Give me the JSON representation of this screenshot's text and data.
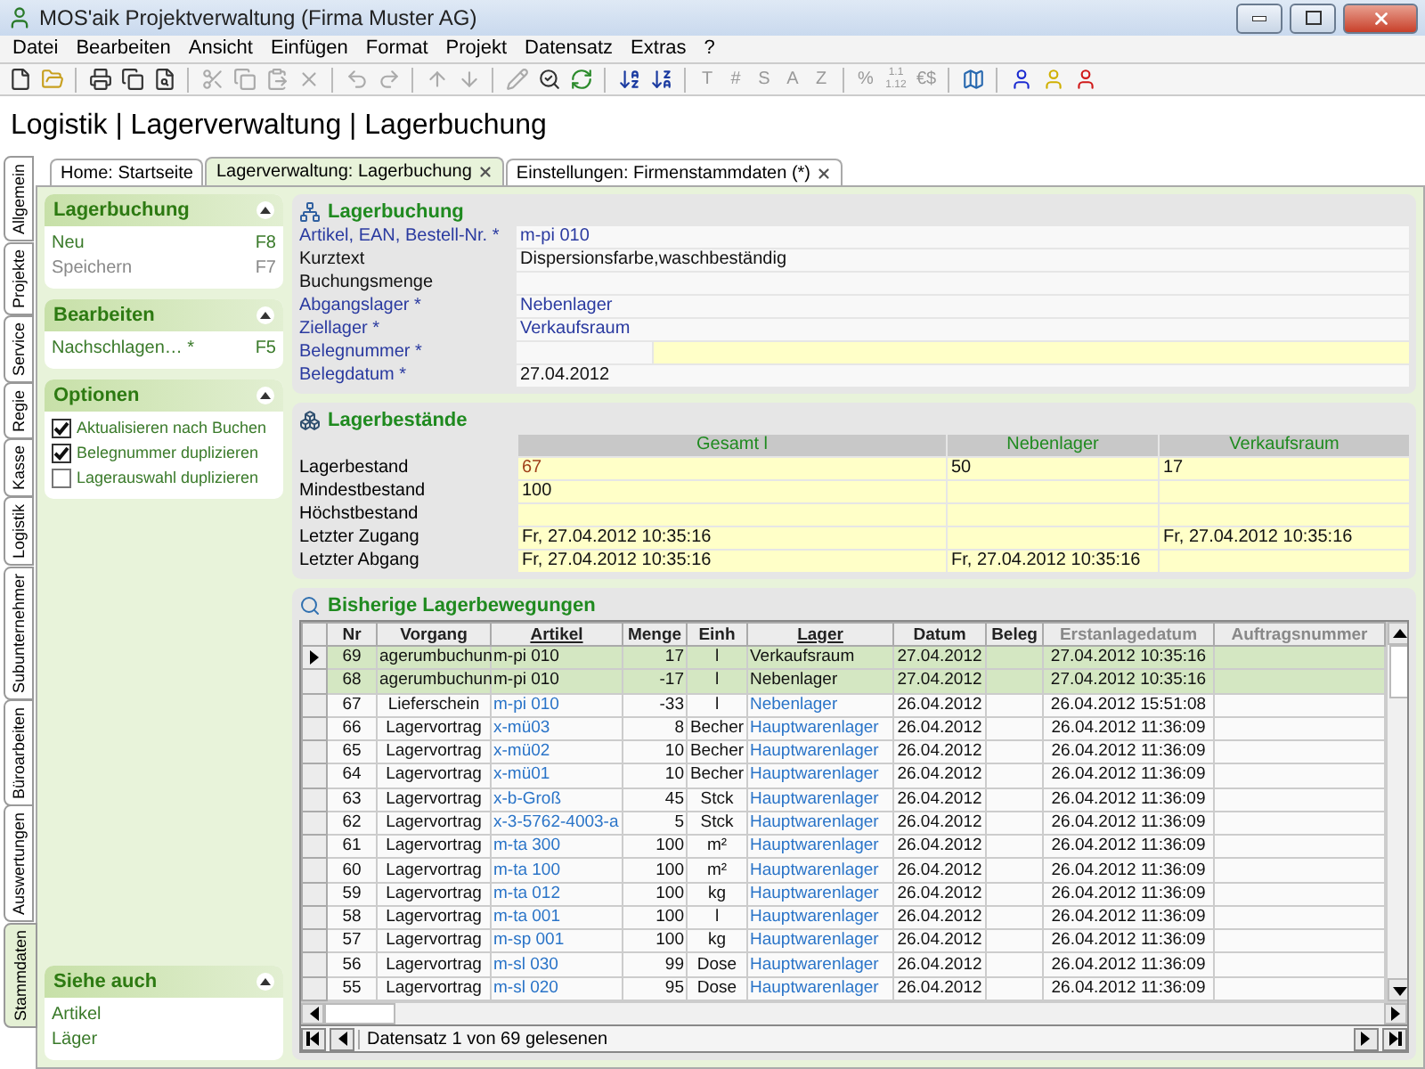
{
  "window": {
    "title": "MOS'aik Projektverwaltung (Firma Muster AG)"
  },
  "menu": [
    "Datei",
    "Bearbeiten",
    "Ansicht",
    "Einfügen",
    "Format",
    "Projekt",
    "Datensatz",
    "Extras",
    "?"
  ],
  "toolbar_text": [
    {
      "label": "T",
      "disabled": true
    },
    {
      "label": "#",
      "disabled": true
    },
    {
      "label": "S",
      "disabled": true
    },
    {
      "label": "A",
      "disabled": true
    },
    {
      "label": "Z",
      "disabled": true
    },
    {
      "label": "%",
      "disabled": true
    },
    {
      "label": "1.1 1.12",
      "disabled": true
    },
    {
      "label": "€$",
      "disabled": true
    }
  ],
  "page_title": "Logistik | Lagerverwaltung | Lagerbuchung",
  "vertical_tabs": [
    {
      "label": "Allgemein",
      "selected": false
    },
    {
      "label": "Projekte",
      "selected": false
    },
    {
      "label": "Service",
      "selected": false
    },
    {
      "label": "Regie",
      "selected": false
    },
    {
      "label": "Kasse",
      "selected": false
    },
    {
      "label": "Logistik",
      "selected": false
    },
    {
      "label": "Subunternehmer",
      "selected": false
    },
    {
      "label": "Büroarbeiten",
      "selected": false
    },
    {
      "label": "Auswertungen",
      "selected": false
    },
    {
      "label": "Stammdaten",
      "selected": true
    }
  ],
  "tabs": [
    {
      "label": "Home: Startseite",
      "selected": false,
      "closable": false
    },
    {
      "label": "Lagerverwaltung: Lagerbuchung",
      "selected": true,
      "closable": true
    },
    {
      "label": "Einstellungen: Firmenstammdaten (*)",
      "selected": false,
      "closable": true
    }
  ],
  "sidebar": [
    {
      "title": "Lagerbuchung",
      "items": [
        {
          "kind": "action",
          "label": "Neu",
          "key": "F8",
          "disabled": false
        },
        {
          "kind": "action",
          "label": "Speichern",
          "key": "F7",
          "disabled": true
        }
      ]
    },
    {
      "title": "Bearbeiten",
      "items": [
        {
          "kind": "action",
          "label": "Nachschlagen… *",
          "key": "F5",
          "disabled": false
        }
      ]
    },
    {
      "title": "Optionen",
      "items": [
        {
          "kind": "checkbox",
          "label": "Aktualisieren nach Buchen",
          "checked": true
        },
        {
          "kind": "checkbox",
          "label": "Belegnummer duplizieren",
          "checked": true
        },
        {
          "kind": "checkbox",
          "label": "Lagerauswahl duplizieren",
          "checked": false
        }
      ]
    }
  ],
  "see_also": {
    "title": "Siehe auch",
    "items": [
      "Artikel",
      "Läger"
    ]
  },
  "booking": {
    "title": "Lagerbuchung",
    "fields": [
      {
        "label": "Artikel, EAN, Bestell-Nr. *",
        "value": "m-pi 010",
        "required": true,
        "link": true,
        "kind": "text"
      },
      {
        "label": "Kurztext",
        "value": "Dispersionsfarbe,waschbeständig",
        "required": false,
        "link": false,
        "kind": "text"
      },
      {
        "label": "Buchungsmenge",
        "required": false,
        "kind": "text"
      },
      {
        "label": "Abgangslager *",
        "value": "Nebenlager",
        "required": true,
        "link": true,
        "kind": "text"
      },
      {
        "label": "Ziellager *",
        "value": "Verkaufsraum",
        "required": true,
        "link": true,
        "kind": "text"
      },
      {
        "label": "Belegnummer *",
        "required": true,
        "kind": "split"
      },
      {
        "label": "Belegdatum *",
        "value": "27.04.2012",
        "required": true,
        "link": false,
        "kind": "text"
      }
    ]
  },
  "stocks": {
    "title": "Lagerbestände",
    "columns": [
      "Gesamt l",
      "Nebenlager",
      "Verkaufsraum"
    ],
    "rows": [
      {
        "label": "Lagerbestand",
        "cells": [
          "67",
          "50",
          "17"
        ],
        "below_minimum": true
      },
      {
        "label": "Mindestbestand",
        "cells": [
          "100",
          "",
          ""
        ]
      },
      {
        "label": "Höchstbestand",
        "cells": [
          "",
          "",
          ""
        ]
      },
      {
        "label": "Letzter Zugang",
        "cells": [
          "Fr, 27.04.2012 10:35:16",
          "",
          "Fr, 27.04.2012 10:35:16"
        ]
      },
      {
        "label": "Letzter Abgang",
        "cells": [
          "Fr, 27.04.2012 10:35:16",
          "Fr, 27.04.2012 10:35:16",
          ""
        ]
      }
    ]
  },
  "movements": {
    "title": "Bisherige Lagerbewegungen",
    "columns": [
      {
        "label": "Nr",
        "link": false,
        "disabled": false
      },
      {
        "label": "Vorgang",
        "link": false,
        "disabled": false
      },
      {
        "label": "Artikel",
        "link": true,
        "disabled": false
      },
      {
        "label": "Menge",
        "link": false,
        "disabled": false
      },
      {
        "label": "Einh",
        "link": false,
        "disabled": false
      },
      {
        "label": "Lager",
        "link": true,
        "disabled": false
      },
      {
        "label": "Datum",
        "link": false,
        "disabled": false
      },
      {
        "label": "Beleg",
        "link": false,
        "disabled": false
      },
      {
        "label": "Erstanlagedatum",
        "link": false,
        "disabled": true
      },
      {
        "label": "Auftragsnummer",
        "link": false,
        "disabled": true
      }
    ],
    "rows": [
      {
        "current": true,
        "selected": true,
        "cells": [
          "69",
          "agerumbuchun",
          "m-pi 010",
          "17",
          "l",
          "Verkaufsraum",
          "27.04.2012",
          "",
          "27.04.2012 10:35:16",
          ""
        ]
      },
      {
        "current": false,
        "selected": true,
        "cells": [
          "68",
          "agerumbuchun",
          "m-pi 010",
          "-17",
          "l",
          "Nebenlager",
          "27.04.2012",
          "",
          "27.04.2012 10:35:16",
          ""
        ]
      },
      {
        "current": false,
        "selected": false,
        "cells": [
          "67",
          "Lieferschein",
          "m-pi 010",
          "-33",
          "l",
          "Nebenlager",
          "26.04.2012",
          "",
          "26.04.2012 15:51:08",
          ""
        ]
      },
      {
        "current": false,
        "selected": false,
        "cells": [
          "66",
          "Lagervortrag",
          "x-mü03",
          "8",
          "Becher",
          "Hauptwarenlager",
          "26.04.2012",
          "",
          "26.04.2012 11:36:09",
          ""
        ]
      },
      {
        "current": false,
        "selected": false,
        "cells": [
          "65",
          "Lagervortrag",
          "x-mü02",
          "10",
          "Becher",
          "Hauptwarenlager",
          "26.04.2012",
          "",
          "26.04.2012 11:36:09",
          ""
        ]
      },
      {
        "current": false,
        "selected": false,
        "cells": [
          "64",
          "Lagervortrag",
          "x-mü01",
          "10",
          "Becher",
          "Hauptwarenlager",
          "26.04.2012",
          "",
          "26.04.2012 11:36:09",
          ""
        ]
      },
      {
        "current": false,
        "selected": false,
        "cells": [
          "63",
          "Lagervortrag",
          "x-b-Groß",
          "45",
          "Stck",
          "Hauptwarenlager",
          "26.04.2012",
          "",
          "26.04.2012 11:36:09",
          ""
        ]
      },
      {
        "current": false,
        "selected": false,
        "cells": [
          "62",
          "Lagervortrag",
          "x-3-5762-4003-a",
          "5",
          "Stck",
          "Hauptwarenlager",
          "26.04.2012",
          "",
          "26.04.2012 11:36:09",
          ""
        ]
      },
      {
        "current": false,
        "selected": false,
        "cells": [
          "61",
          "Lagervortrag",
          "m-ta 300",
          "100",
          "m²",
          "Hauptwarenlager",
          "26.04.2012",
          "",
          "26.04.2012 11:36:09",
          ""
        ]
      },
      {
        "current": false,
        "selected": false,
        "cells": [
          "60",
          "Lagervortrag",
          "m-ta 100",
          "100",
          "m²",
          "Hauptwarenlager",
          "26.04.2012",
          "",
          "26.04.2012 11:36:09",
          ""
        ]
      },
      {
        "current": false,
        "selected": false,
        "cells": [
          "59",
          "Lagervortrag",
          "m-ta 012",
          "100",
          "kg",
          "Hauptwarenlager",
          "26.04.2012",
          "",
          "26.04.2012 11:36:09",
          ""
        ]
      },
      {
        "current": false,
        "selected": false,
        "cells": [
          "58",
          "Lagervortrag",
          "m-ta 001",
          "100",
          "l",
          "Hauptwarenlager",
          "26.04.2012",
          "",
          "26.04.2012 11:36:09",
          ""
        ]
      },
      {
        "current": false,
        "selected": false,
        "cells": [
          "57",
          "Lagervortrag",
          "m-sp 001",
          "100",
          "kg",
          "Hauptwarenlager",
          "26.04.2012",
          "",
          "26.04.2012 11:36:09",
          ""
        ]
      },
      {
        "current": false,
        "selected": false,
        "cells": [
          "56",
          "Lagervortrag",
          "m-sl 030",
          "99",
          "Dose",
          "Hauptwarenlager",
          "26.04.2012",
          "",
          "26.04.2012 11:36:09",
          ""
        ]
      },
      {
        "current": false,
        "selected": false,
        "cells": [
          "55",
          "Lagervortrag",
          "m-sl 020",
          "95",
          "Dose",
          "Hauptwarenlager",
          "26.04.2012",
          "",
          "26.04.2012 11:36:09",
          ""
        ]
      }
    ],
    "status": "Datensatz 1 von 69 gelesenen"
  }
}
